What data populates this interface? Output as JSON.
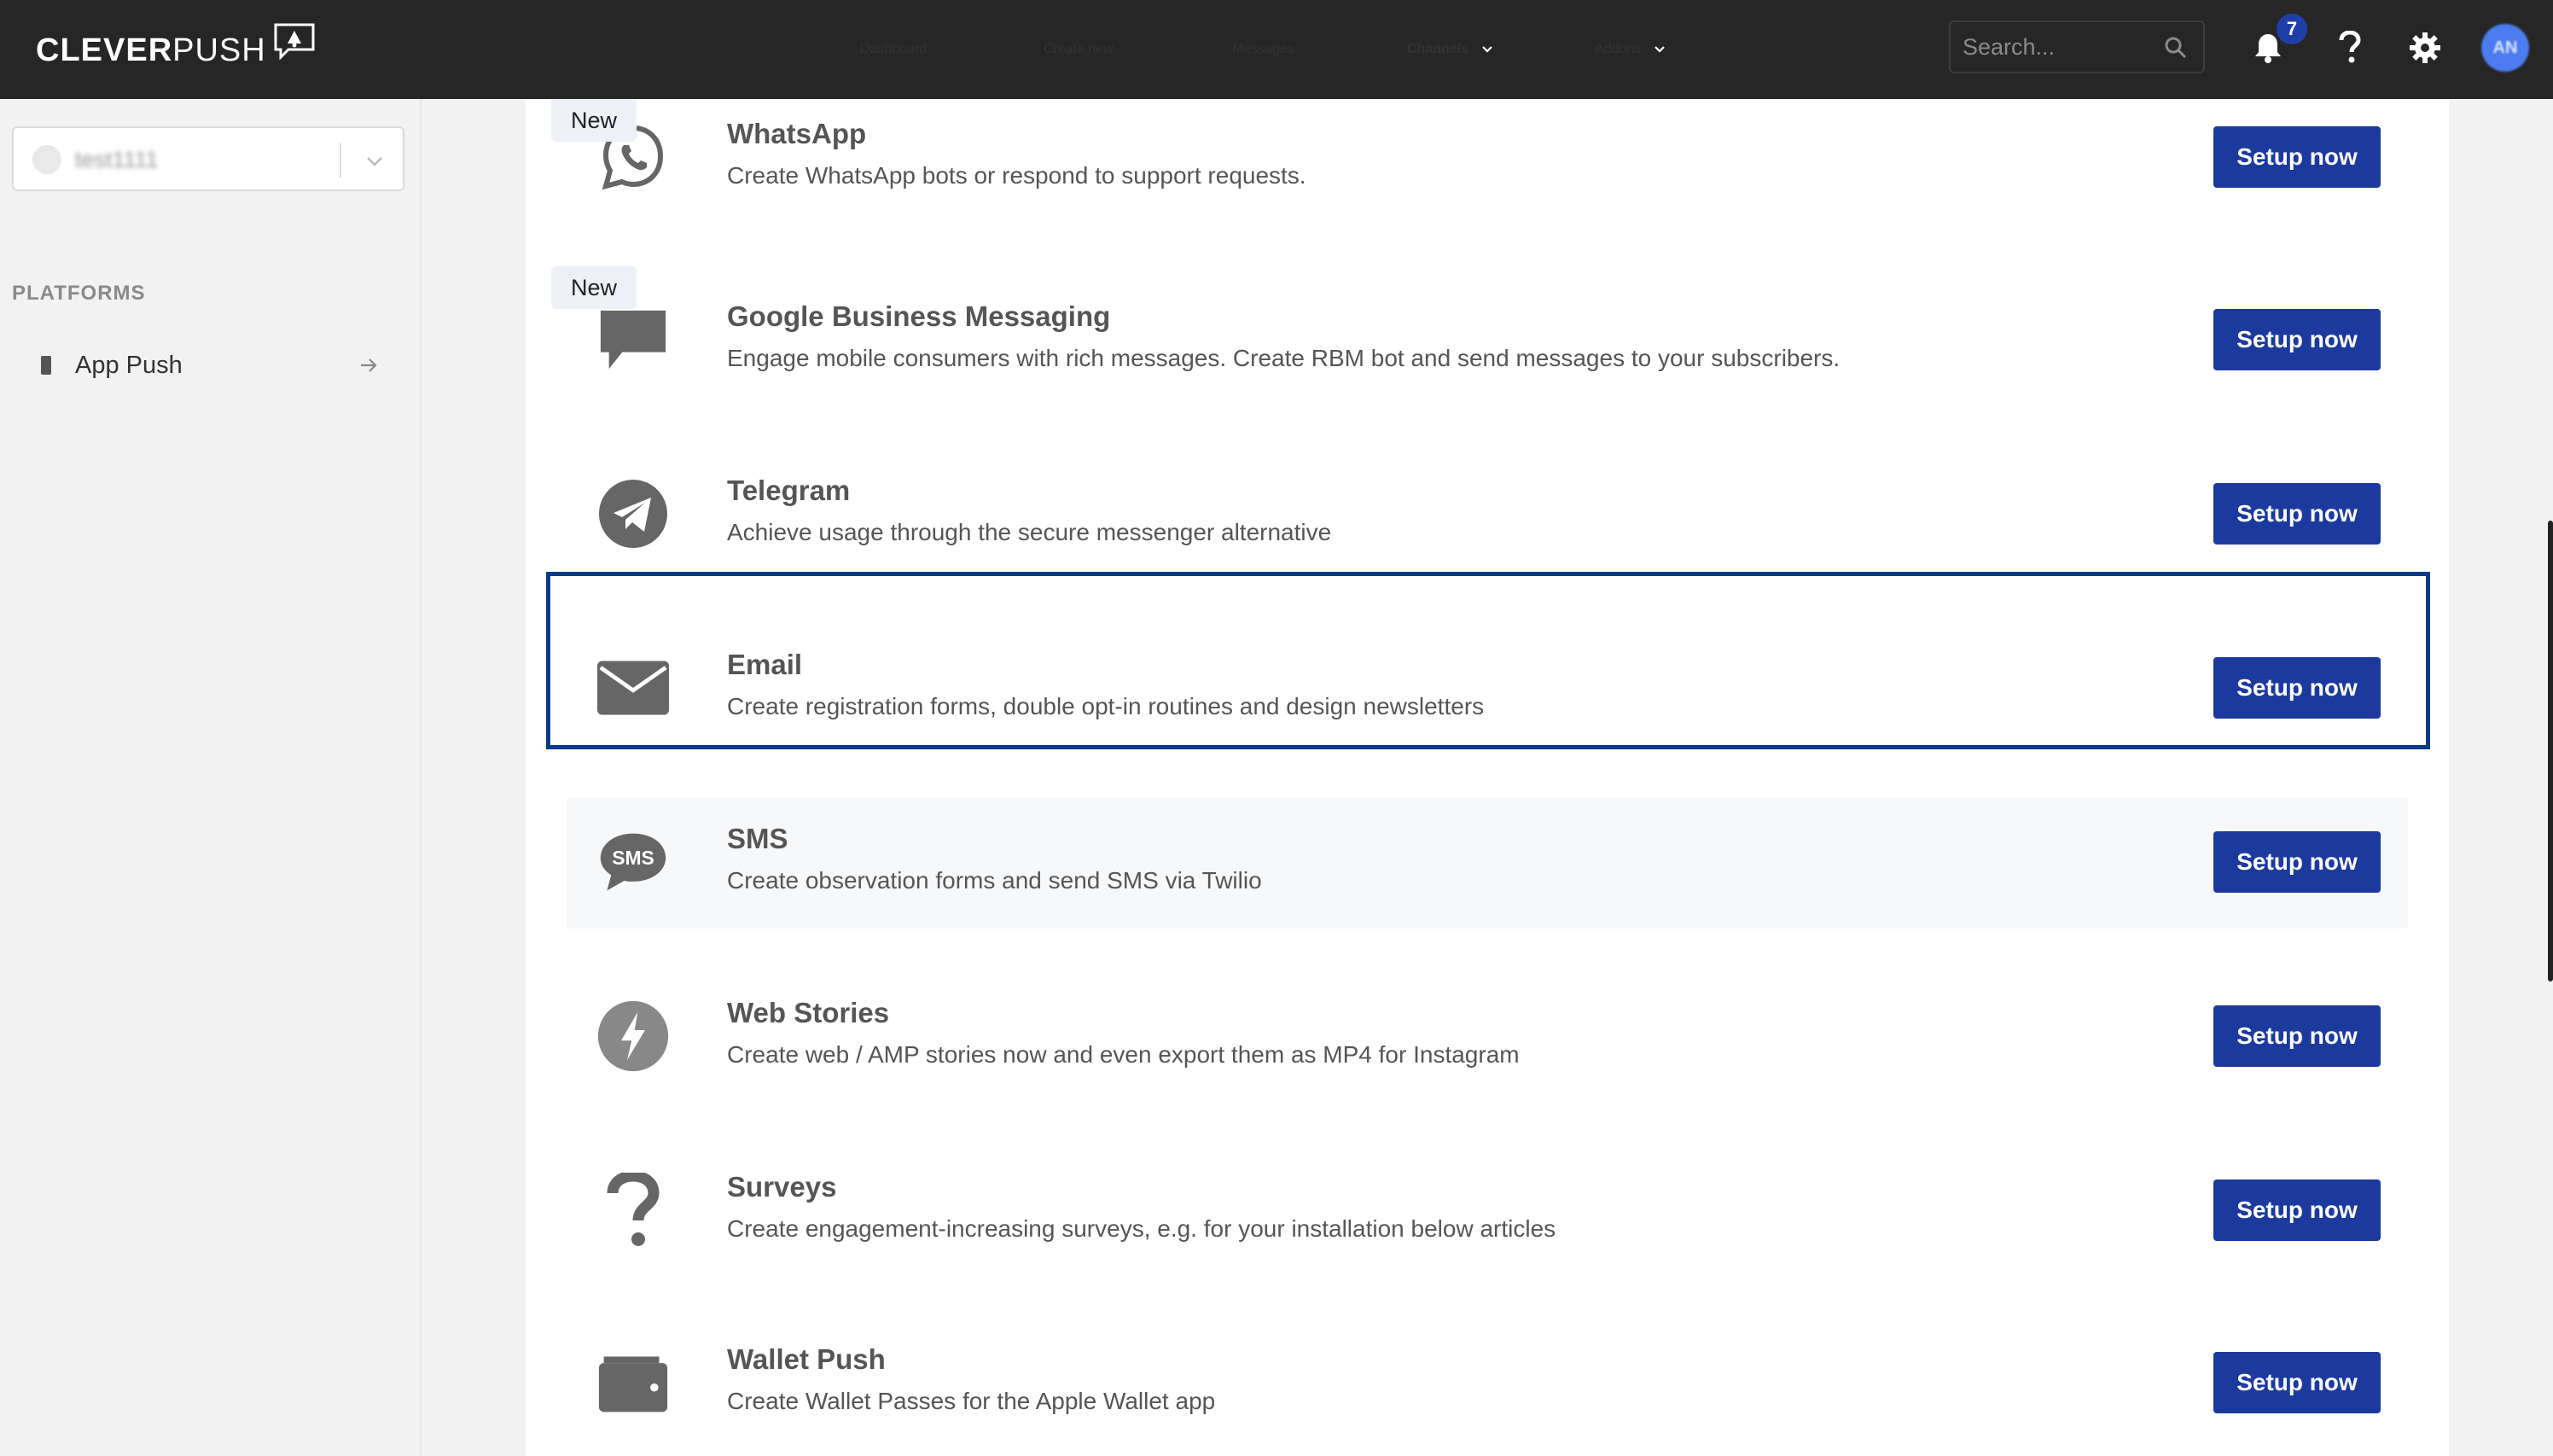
{
  "header": {
    "logo_text_bold": "CLEVER",
    "logo_text_light": "PUSH",
    "nav": [
      {
        "label": "Dashboard"
      },
      {
        "label": "Create new"
      },
      {
        "label": "Messages"
      },
      {
        "label": "Channels"
      },
      {
        "label": "Addons"
      }
    ],
    "search_placeholder": "Search...",
    "notification_count": "7",
    "avatar_initials": "AN"
  },
  "sidebar": {
    "project_name": "test1111",
    "platforms_label": "PLATFORMS",
    "items": [
      {
        "label": "App Push"
      }
    ]
  },
  "channels": [
    {
      "title": "WhatsApp",
      "description": "Create WhatsApp bots or respond to support requests.",
      "button": "Setup now",
      "badge": "New",
      "icon": "whatsapp-icon"
    },
    {
      "title": "Google Business Messaging",
      "description": "Engage mobile consumers with rich messages. Create RBM bot and send messages to your subscribers.",
      "button": "Setup now",
      "badge": "New",
      "icon": "chat-bubble-icon"
    },
    {
      "title": "Telegram",
      "description": "Achieve usage through the secure messenger alternative",
      "button": "Setup now",
      "icon": "telegram-icon"
    },
    {
      "title": "Email",
      "description": "Create registration forms, double opt-in routines and design newsletters",
      "button": "Setup now",
      "icon": "envelope-icon"
    },
    {
      "title": "SMS",
      "description": "Create observation forms and send SMS via Twilio",
      "button": "Setup now",
      "icon": "sms-icon",
      "icon_text": "SMS"
    },
    {
      "title": "Web Stories",
      "description": "Create web / AMP stories now and even export them as MP4 for Instagram",
      "button": "Setup now",
      "icon": "lightning-icon"
    },
    {
      "title": "Surveys",
      "description": "Create engagement-increasing surveys, e.g. for your installation below articles",
      "button": "Setup now",
      "icon": "question-mark-icon"
    },
    {
      "title": "Wallet Push",
      "description": "Create Wallet Passes for the Apple Wallet app",
      "button": "Setup now",
      "icon": "wallet-icon"
    }
  ],
  "colors": {
    "topbar": "#262626",
    "button": "#1c3a9e",
    "highlight_border": "#0a3a8a"
  }
}
